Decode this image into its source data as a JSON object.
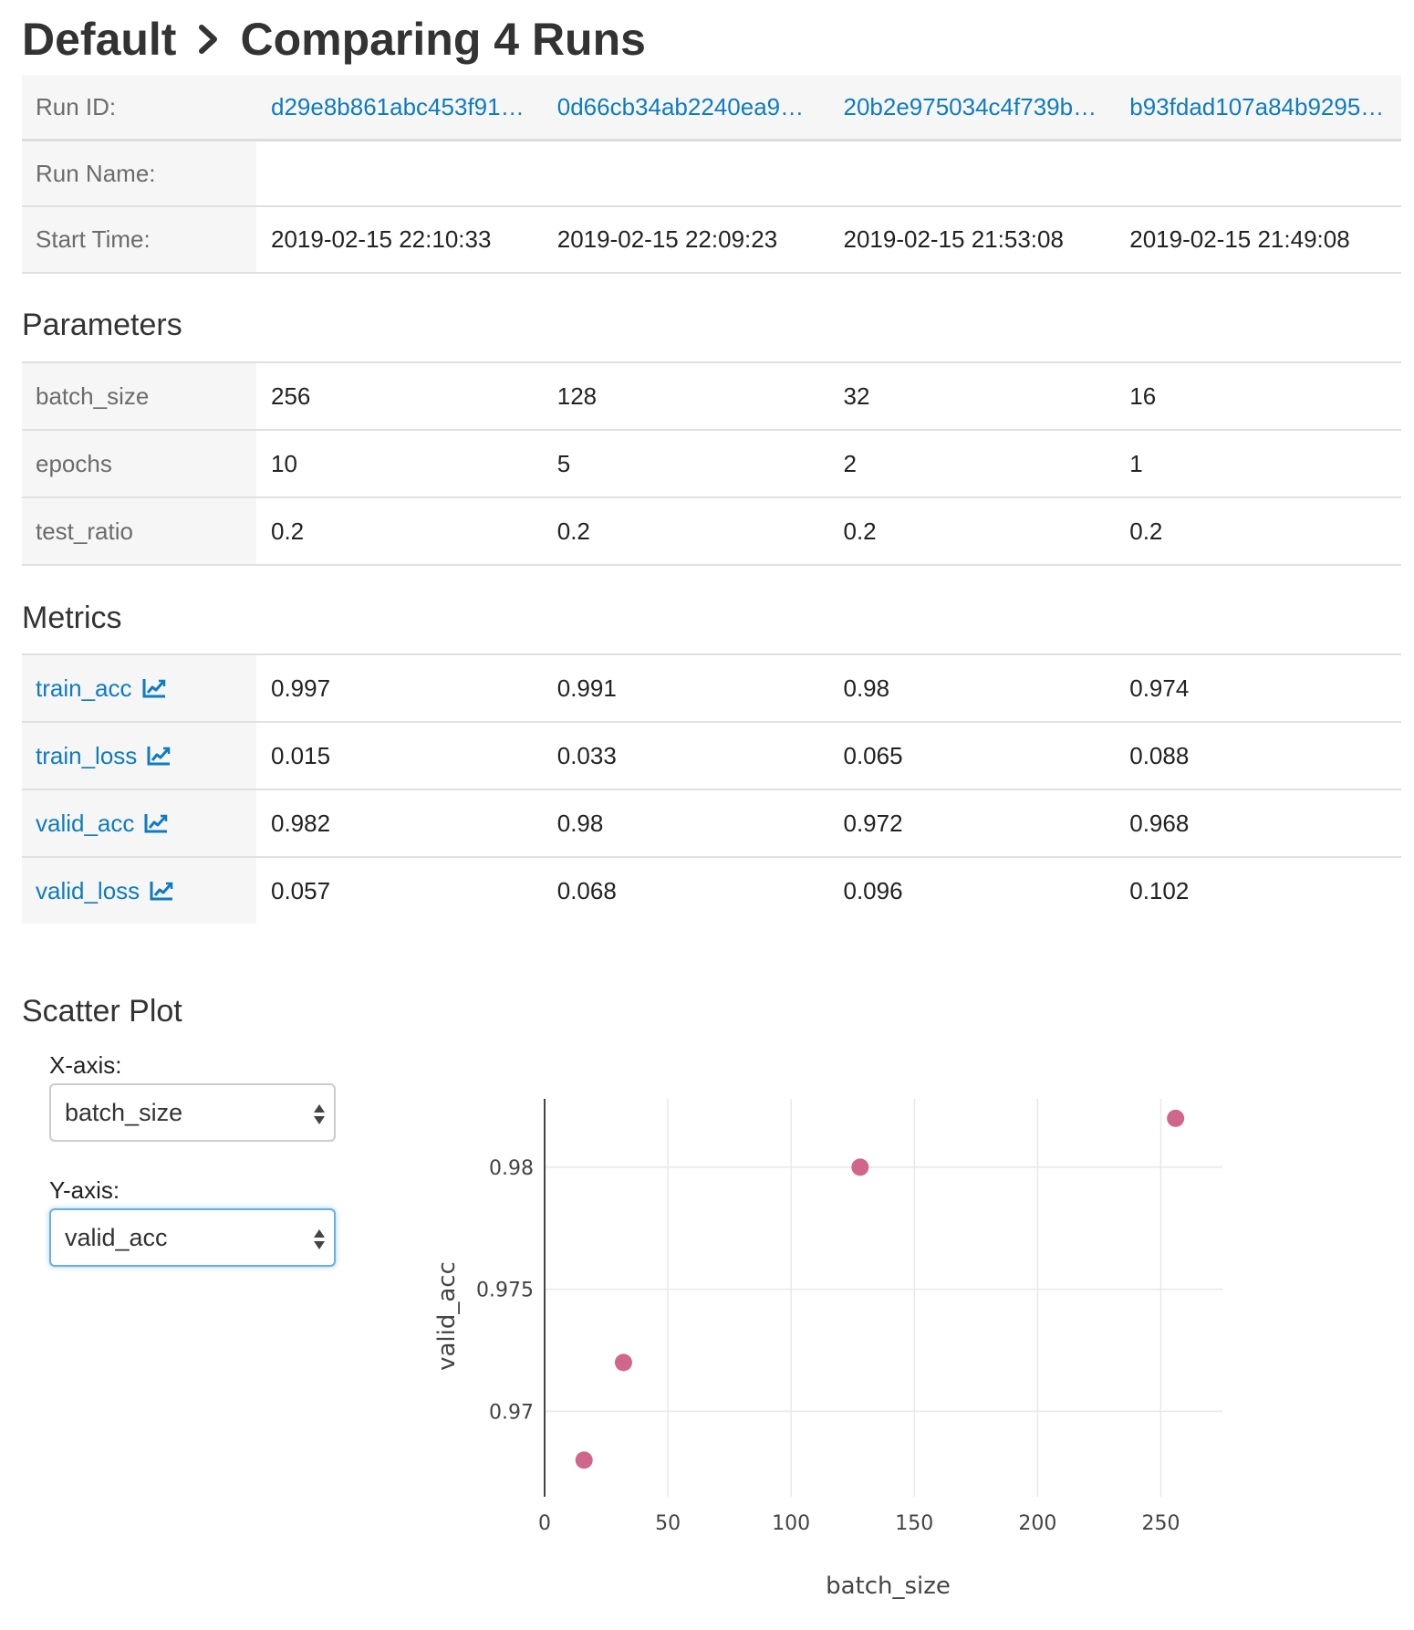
{
  "header": {
    "breadcrumb_root": "Default",
    "page_title": "Comparing 4 Runs"
  },
  "runs_table": {
    "run_id_label": "Run ID:",
    "run_name_label": "Run Name:",
    "start_time_label": "Start Time:",
    "runs": [
      {
        "id": "d29e8b861abc453f91…",
        "name": "",
        "start_time": "2019-02-15 22:10:33"
      },
      {
        "id": "0d66cb34ab2240ea9…",
        "name": "",
        "start_time": "2019-02-15 22:09:23"
      },
      {
        "id": "20b2e975034c4f739b…",
        "name": "",
        "start_time": "2019-02-15 21:53:08"
      },
      {
        "id": "b93fdad107a84b9295…",
        "name": "",
        "start_time": "2019-02-15 21:49:08"
      }
    ]
  },
  "parameters": {
    "title": "Parameters",
    "rows": [
      {
        "name": "batch_size",
        "values": [
          "256",
          "128",
          "32",
          "16"
        ]
      },
      {
        "name": "epochs",
        "values": [
          "10",
          "5",
          "2",
          "1"
        ]
      },
      {
        "name": "test_ratio",
        "values": [
          "0.2",
          "0.2",
          "0.2",
          "0.2"
        ]
      }
    ]
  },
  "metrics": {
    "title": "Metrics",
    "rows": [
      {
        "name": "train_acc",
        "icon": "line-chart-icon",
        "values": [
          "0.997",
          "0.991",
          "0.98",
          "0.974"
        ]
      },
      {
        "name": "train_loss",
        "icon": "line-chart-icon",
        "values": [
          "0.015",
          "0.033",
          "0.065",
          "0.088"
        ]
      },
      {
        "name": "valid_acc",
        "icon": "line-chart-icon",
        "values": [
          "0.982",
          "0.98",
          "0.972",
          "0.968"
        ]
      },
      {
        "name": "valid_loss",
        "icon": "line-chart-icon",
        "values": [
          "0.057",
          "0.068",
          "0.096",
          "0.102"
        ]
      }
    ]
  },
  "scatter_plot": {
    "title": "Scatter Plot",
    "x_axis_label": "X-axis:",
    "x_axis_selected": "batch_size",
    "y_axis_label": "Y-axis:",
    "y_axis_selected": "valid_acc"
  },
  "colors": {
    "link": "#0f7bc0",
    "marker": "#d0668c",
    "label_bg": "#f6f6f6",
    "focus_border": "#66afe9"
  },
  "chart_data": {
    "type": "scatter",
    "x": [
      256,
      128,
      32,
      16
    ],
    "y": [
      0.982,
      0.98,
      0.972,
      0.968
    ],
    "xlabel": "batch_size",
    "ylabel": "valid_acc",
    "xlim": [
      0,
      275
    ],
    "ylim": [
      0.9665,
      0.9828
    ],
    "x_ticks": [
      0,
      50,
      100,
      150,
      200,
      250
    ],
    "x_tick_labels": [
      "0",
      "50",
      "100",
      "150",
      "200",
      "250"
    ],
    "y_ticks": [
      0.97,
      0.975,
      0.98
    ],
    "y_tick_labels": [
      "0.97",
      "0.975",
      "0.98"
    ],
    "grid": true,
    "marker_color": "#d0668c"
  }
}
